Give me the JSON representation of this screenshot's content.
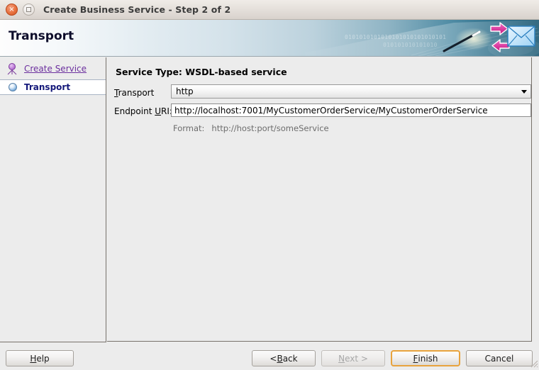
{
  "window": {
    "title": "Create Business Service - Step 2 of 2",
    "close_icon": "close-icon",
    "maximize_icon": "maximize-icon",
    "close_glyph": "×"
  },
  "banner": {
    "title": "Transport",
    "binary_top": "0101010101010101010101010101",
    "binary_bottom": "010101010101010",
    "envelope_icon": "envelope-icon",
    "arrow_right_icon": "arrow-right-icon",
    "arrow_left_icon": "arrow-left-icon",
    "wand_icon": "wand-icon"
  },
  "sidebar": {
    "items": [
      {
        "label": "Create Service",
        "icon": "tree-node-icon",
        "state": "link"
      },
      {
        "label": "Transport",
        "icon": "sphere-icon",
        "state": "selected"
      }
    ]
  },
  "main": {
    "service_type": "Service Type: WSDL-based service",
    "transport": {
      "label_mnemonic": "T",
      "label_rest": "ransport",
      "value": "http",
      "arrow_icon": "chevron-down-icon"
    },
    "endpoint": {
      "label_pre": "Endpoint ",
      "label_mnemonic": "U",
      "label_rest": "RI:",
      "value": "http://localhost:7001/MyCustomerOrderService/MyCustomerOrderService"
    },
    "format": {
      "key": "Format:",
      "value": "http://host:port/someService"
    }
  },
  "buttons": {
    "help": {
      "mnemonic": "H",
      "pre": "",
      "rest": "elp"
    },
    "back": {
      "mnemonic": "B",
      "pre": "< ",
      "rest": "ack"
    },
    "next": {
      "mnemonic": "N",
      "pre": "",
      "rest": "ext >",
      "disabled": "true"
    },
    "finish": {
      "mnemonic": "F",
      "pre": "",
      "rest": "inish"
    },
    "cancel": {
      "mnemonic": "",
      "pre": "Cancel",
      "rest": ""
    }
  },
  "colors": {
    "accent_focus": "#e8a33d",
    "link": "#6b2f9e",
    "selected_text": "#14187a",
    "banner_end": "#1d5a74"
  }
}
